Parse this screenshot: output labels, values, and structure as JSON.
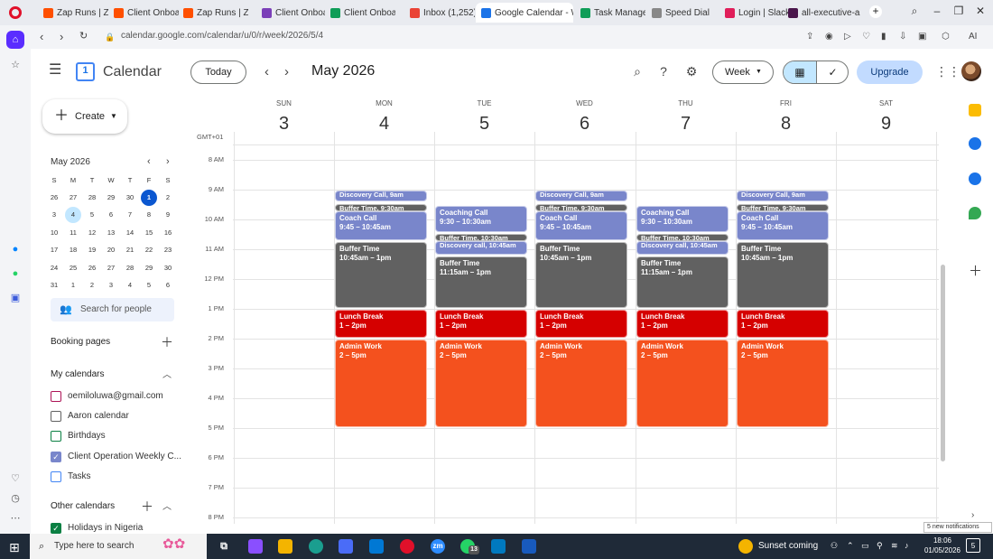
{
  "browser": {
    "tabs": [
      {
        "label": "Zap Runs | Zap",
        "color": "#ff4f00"
      },
      {
        "label": "Client Onboard",
        "color": "#ff4f00"
      },
      {
        "label": "Zap Runs | Zap",
        "color": "#ff4f00"
      },
      {
        "label": "Client Onboard",
        "color": "#7b3fb8"
      },
      {
        "label": "Client Onboard",
        "color": "#0f9d58"
      },
      {
        "label": "Inbox (1,252) -",
        "color": "#ea4335"
      },
      {
        "label": "Google Calendar - Week",
        "color": "#1a73e8"
      },
      {
        "label": "Task Managem",
        "color": "#0f9d58"
      },
      {
        "label": "Speed Dial",
        "color": "#888888"
      },
      {
        "label": "Login | Slack",
        "color": "#e01e5a"
      },
      {
        "label": "all-executive-a",
        "color": "#4a154b"
      }
    ],
    "new_tab": "+",
    "url": "calendar.google.com/calendar/u/0/r/week/2026/5/4",
    "ai_label": "AI"
  },
  "calendar": {
    "app_name": "Calendar",
    "logo_num": "1",
    "today_label": "Today",
    "month_title": "May 2026",
    "view_label": "Week",
    "upgrade_label": "Upgrade",
    "create_label": "Create",
    "timezone": "GMT+01",
    "days": [
      {
        "name": "SUN",
        "num": "3"
      },
      {
        "name": "MON",
        "num": "4"
      },
      {
        "name": "TUE",
        "num": "5"
      },
      {
        "name": "WED",
        "num": "6"
      },
      {
        "name": "THU",
        "num": "7"
      },
      {
        "name": "FRI",
        "num": "8"
      },
      {
        "name": "SAT",
        "num": "9"
      }
    ],
    "hours": [
      "8 AM",
      "9 AM",
      "10 AM",
      "11 AM",
      "12 PM",
      "1 PM",
      "2 PM",
      "3 PM",
      "4 PM",
      "5 PM",
      "6 PM",
      "7 PM",
      "8 PM"
    ],
    "colors": {
      "lavender": "#7986cb",
      "graphite": "#616161",
      "tomato": "#d50000",
      "tangerine": "#f4511e"
    }
  },
  "mini_calendar": {
    "title": "May 2026",
    "weekdays": [
      "S",
      "M",
      "T",
      "W",
      "T",
      "F",
      "S"
    ],
    "weeks": [
      [
        "26",
        "27",
        "28",
        "29",
        "30",
        "1",
        "2"
      ],
      [
        "3",
        "4",
        "5",
        "6",
        "7",
        "8",
        "9"
      ],
      [
        "10",
        "11",
        "12",
        "13",
        "14",
        "15",
        "16"
      ],
      [
        "17",
        "18",
        "19",
        "20",
        "21",
        "22",
        "23"
      ],
      [
        "24",
        "25",
        "26",
        "27",
        "28",
        "29",
        "30"
      ],
      [
        "31",
        "1",
        "2",
        "3",
        "4",
        "5",
        "6"
      ]
    ],
    "today": "1",
    "selected": "4"
  },
  "sidebar": {
    "search_people_placeholder": "Search for people",
    "booking_pages_label": "Booking pages",
    "my_calendars_label": "My calendars",
    "my_calendars": [
      {
        "name": "oemiloluwa@gmail.com",
        "checked": false,
        "color": "#ad1457"
      },
      {
        "name": "Aaron calendar",
        "checked": false,
        "color": "#616161"
      },
      {
        "name": "Birthdays",
        "checked": false,
        "color": "#0b8043"
      },
      {
        "name": "Client Operation Weekly C...",
        "checked": true,
        "color": "#7986cb"
      },
      {
        "name": "Tasks",
        "checked": false,
        "color": "#4285f4"
      }
    ],
    "other_calendars_label": "Other calendars",
    "other_calendars": [
      {
        "name": "Holidays in Nigeria",
        "checked": true,
        "color": "#0b8043"
      }
    ]
  },
  "events": {
    "discovery_call": "Discovery Call, 9am",
    "discovery_call_1045": "Discovery call, 10:45am",
    "buffer_930": "Buffer Time, 9:30am",
    "buffer_1030": "Buffer Time, 10:30am",
    "coach_call_title": "Coach Call",
    "coaching_call_title": "Coaching Call",
    "coach_time": "9:45 – 10:45am",
    "coaching_930_time": "9:30 – 10:30am",
    "buffer_title": "Buffer Time",
    "buffer_1045_time": "10:45am – 1pm",
    "buffer_1115_time": "11:15am – 1pm",
    "lunch_title": "Lunch Break",
    "lunch_time": "1 – 2pm",
    "admin_title": "Admin Work",
    "admin_time": "2 – 5pm"
  },
  "notifications_toast": "5 new notifications",
  "taskbar": {
    "search_placeholder": "Type here to search",
    "weather": "Sunset coming",
    "time": "18:06",
    "date": "01/05/2026",
    "notif_count": "5",
    "whatsapp_badge": "13"
  }
}
